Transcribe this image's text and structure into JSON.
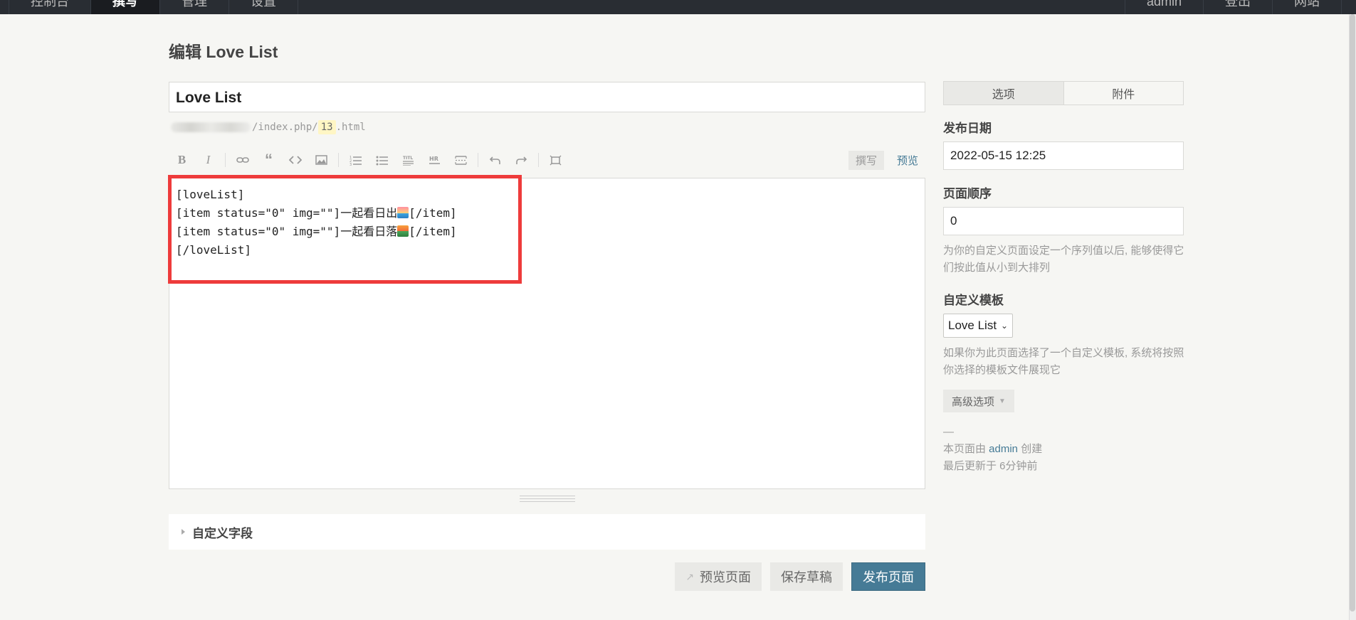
{
  "topnav": {
    "left": [
      "控制台",
      "撰写",
      "管理",
      "设置"
    ],
    "right": [
      "admin",
      "登出",
      "网站"
    ]
  },
  "page": {
    "title": "编辑 Love List"
  },
  "editor": {
    "title_value": "Love List",
    "permalink_prefix": "/index.php/",
    "permalink_slug": "13",
    "permalink_suffix": ".html",
    "toolbar": {
      "icons": [
        "bold-icon",
        "italic-icon",
        "link-icon",
        "quote-icon",
        "code-icon",
        "image-icon",
        "ordered-list-icon",
        "unordered-list-icon",
        "heading-icon",
        "hr-icon",
        "more-icon",
        "undo-icon",
        "redo-icon",
        "fullscreen-icon"
      ],
      "write_tab": "撰写",
      "preview_tab": "预览"
    },
    "lines": {
      "l1": "[loveList]",
      "l2a": "[item status=\"0\" img=\"\"]一起看日出",
      "l2b": "[/item]",
      "l3a": "[item status=\"0\" img=\"\"]一起看日落",
      "l3b": "[/item]",
      "l4": "[/loveList]"
    },
    "highlight_color": "#ee3b3b"
  },
  "custom_fields": {
    "label": "自定义字段"
  },
  "actions": {
    "preview": "预览页面",
    "save_draft": "保存草稿",
    "publish": "发布页面"
  },
  "sidebar": {
    "tabs": [
      "选项",
      "附件"
    ],
    "publish_date_label": "发布日期",
    "publish_date_value": "2022-05-15 12:25",
    "order_label": "页面顺序",
    "order_value": "0",
    "order_desc": "为你的自定义页面设定一个序列值以后, 能够使得它们按此值从小到大排列",
    "template_label": "自定义模板",
    "template_value": "Love List",
    "template_desc": "如果你为此页面选择了一个自定义模板, 系统将按照你选择的模板文件展现它",
    "advanced_label": "高级选项",
    "meta_dash": "—",
    "created_prefix": "本页面由 ",
    "created_user": "admin",
    "created_suffix": " 创建",
    "updated": "最后更新于 6分钟前"
  },
  "colors": {
    "accent": "#467b96",
    "topbar": "#292d33"
  }
}
